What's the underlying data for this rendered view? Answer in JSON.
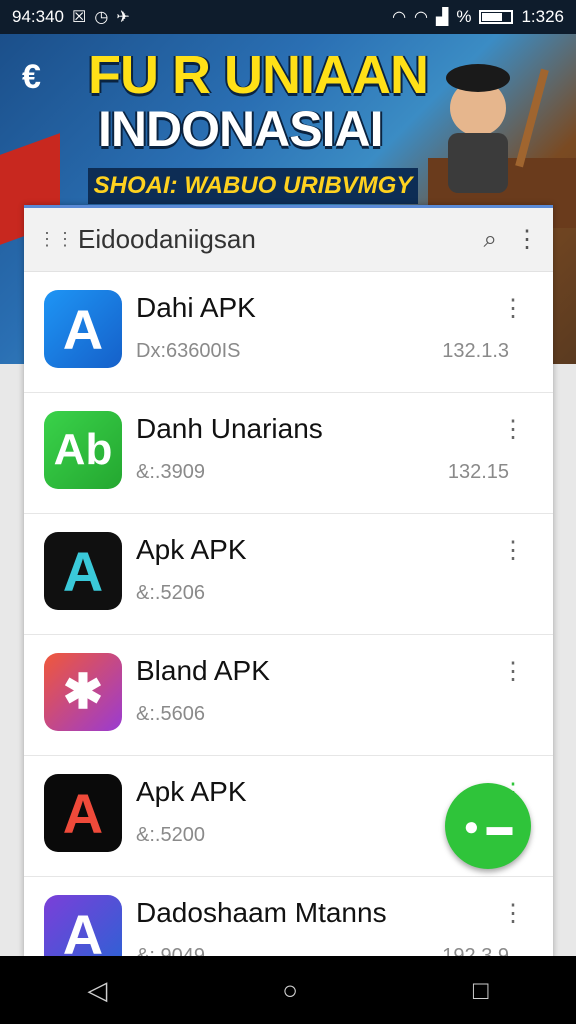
{
  "status_bar": {
    "left_text": "94:340",
    "time": "1:326",
    "battery_label": "%"
  },
  "banner": {
    "title_line1": "FU R UNIAAN",
    "title_line2": "INDONASIAI",
    "subtitle": "SHOAI: WABUO URIBVMGY"
  },
  "sheet": {
    "title": "Eidoodaniigsan",
    "apps": [
      {
        "name": "Dahi APK",
        "sub": "Dx:63600IS",
        "version": "132.1.3",
        "icon_color": "#1f8ff0",
        "icon_letter": "A"
      },
      {
        "name": "Danh Unarians",
        "sub": "&:.3909",
        "version": "132.15",
        "icon_color": "#2fc43a",
        "icon_letter": "Ab"
      },
      {
        "name": "Apk APK",
        "sub": "&:.5206",
        "version": "",
        "icon_color": "#101010",
        "icon_letter": "A"
      },
      {
        "name": "Bland APK",
        "sub": "&:.5606",
        "version": "",
        "icon_color": "#e84a3a",
        "icon_letter": "✱"
      },
      {
        "name": "Apk APK",
        "sub": "&:.5200",
        "version": "",
        "icon_color": "#0a0a0a",
        "icon_letter": "A"
      },
      {
        "name": "Dadoshaam Mtanns",
        "sub": "&:.9049",
        "version": "192.3.9",
        "icon_color": "#5b3fc8",
        "icon_letter": "A"
      }
    ]
  },
  "icons": {
    "back": "back-arrow-icon",
    "search": "search-icon",
    "more": "more-vert-icon",
    "fab": "chat-icon"
  },
  "colors": {
    "accent_green": "#2fc43a",
    "banner_yellow": "#ffe017"
  }
}
